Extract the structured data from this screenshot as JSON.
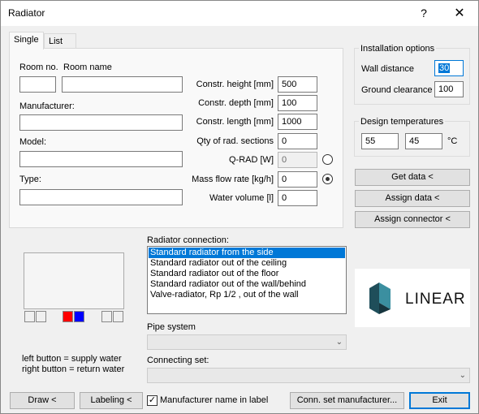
{
  "window": {
    "title": "Radiator",
    "help_label": "?",
    "close_label": "✕"
  },
  "tabs": [
    {
      "label": "Single"
    },
    {
      "label": "List"
    }
  ],
  "room": {
    "no_label": "Room no.",
    "name_label": "Room name",
    "no_value": "",
    "name_value": ""
  },
  "manufacturer": {
    "label": "Manufacturer:",
    "value": ""
  },
  "model": {
    "label": "Model:",
    "value": ""
  },
  "type": {
    "label": "Type:",
    "value": ""
  },
  "fields": {
    "height": {
      "label": "Constr. height [mm]",
      "value": "500"
    },
    "depth": {
      "label": "Constr. depth [mm]",
      "value": "100"
    },
    "length": {
      "label": "Constr. length [mm]",
      "value": "1000"
    },
    "sections": {
      "label": "Qty of rad. sections",
      "value": "0"
    },
    "qrad": {
      "label": "Q-RAD [W]",
      "value": "0"
    },
    "mass_flow": {
      "label": "Mass flow rate [kg/h]",
      "value": "0"
    },
    "water_volume": {
      "label": "Water volume [l]",
      "value": "0"
    }
  },
  "installation": {
    "title": "Installation options",
    "wall_distance_label": "Wall distance",
    "wall_distance_value": "30",
    "ground_clearance_label": "Ground clearance",
    "ground_clearance_value": "100"
  },
  "design_temps": {
    "title": "Design temperatures",
    "supply": "55",
    "return": "45",
    "unit": "°C"
  },
  "side_buttons": {
    "get_data": "Get data <",
    "assign_data": "Assign data <",
    "assign_connector": "Assign connector <"
  },
  "connection": {
    "label": "Radiator connection:",
    "options": [
      "Standard radiator from the side",
      "Standard radiator out of the ceiling",
      "Standard radiator out of the floor",
      "Standard radiator out of the wall/behind",
      "Valve-radiator, Rp 1/2 , out of the wall"
    ],
    "selected_index": 0
  },
  "pipe_system": {
    "label": "Pipe system",
    "value": ""
  },
  "connecting_set": {
    "label": "Connecting set:",
    "value": ""
  },
  "legend": {
    "line1": "left button = supply water",
    "line2": "right button = return water"
  },
  "logo": {
    "text": "LINEAR"
  },
  "colors": {
    "supply_port": "#ff0000",
    "return_port": "#0000ff",
    "selection": "#0078d7",
    "logo_teal": "#1f4e5a"
  },
  "bottom": {
    "draw": "Draw <",
    "labeling": "Labeling <",
    "manufacturer_checkbox_label": "Manufacturer name in label",
    "manufacturer_checked": true,
    "conn_set_manufacturer": "Conn. set manufacturer...",
    "exit": "Exit"
  }
}
